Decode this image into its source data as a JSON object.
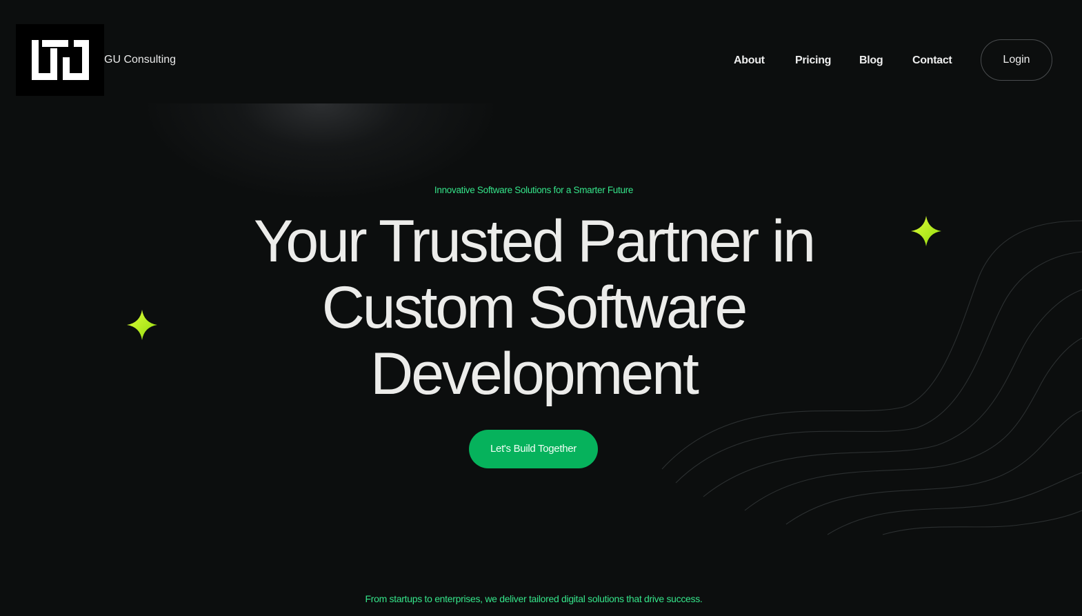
{
  "brand": {
    "name": "GU Consulting",
    "logo_icon": "gu-monogram-logo"
  },
  "nav": {
    "items": [
      {
        "label": "About"
      },
      {
        "label": "Pricing"
      },
      {
        "label": "Blog"
      },
      {
        "label": "Contact"
      }
    ],
    "login_label": "Login"
  },
  "hero": {
    "eyebrow": "Innovative Software Solutions for a Smarter Future",
    "headline_lines": [
      "Your Trusted Partner in",
      "Custom Software",
      "Development"
    ],
    "cta_label": "Let's Build Together",
    "tagline": "From startups to enterprises, we deliver tailored digital solutions that drive success."
  },
  "decor": {
    "sparkle_icon": "four-point-star-icon",
    "waves": "wave-lines-decoration"
  },
  "colors": {
    "background": "#0c0e0e",
    "accent_green": "#06b25c",
    "accent_text_green": "#35e58a",
    "sparkle_lime": "#b8ee12",
    "headline": "#ececea"
  }
}
